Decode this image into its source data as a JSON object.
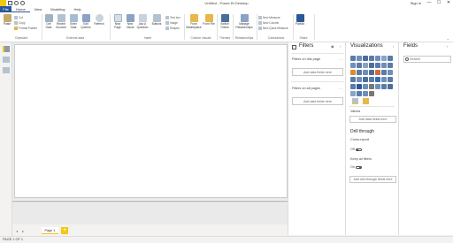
{
  "titlebar": {
    "title": "Untitled - Power BI Desktop",
    "signin": "Sign in",
    "minimize": "—",
    "maximize": "☐",
    "close": "✕"
  },
  "tabs": [
    "File",
    "Home",
    "View",
    "Modeling",
    "Help"
  ],
  "ribbon": {
    "clipboard": {
      "paste": "Paste",
      "cut": "Cut",
      "copy": "Copy",
      "format_painter": "Format Painter",
      "label": "Clipboard"
    },
    "external_data": {
      "get_data": "Get Data",
      "recent_sources": "Recent Sources",
      "enter_data": "Enter Data",
      "edit_queries": "Edit Queries",
      "refresh": "Refresh",
      "label": "External data"
    },
    "insert": {
      "new_page": "New Page",
      "new_visual": "New Visual",
      "ask_a_question": "Ask A Question",
      "buttons": "Buttons",
      "text_box": "Text box",
      "image": "Image",
      "shapes": "Shapes",
      "label": "Insert"
    },
    "custom_visuals": {
      "from_marketplace": "From Marketplace",
      "from_file": "From File",
      "label": "Custom visuals"
    },
    "themes": {
      "switch_theme": "Switch Theme",
      "label": "Themes"
    },
    "relationships": {
      "manage_relationships": "Manage Relationships",
      "label": "Relationships"
    },
    "calculations": {
      "new_measure": "New Measure",
      "new_column": "New Column",
      "new_quick_measure": "New Quick Measure",
      "label": "Calculations"
    },
    "share": {
      "publish": "Publish",
      "label": "Share"
    }
  },
  "canvas": {
    "page_tab": "Page 1",
    "add_page": "+",
    "prev_arrow": "◂",
    "next_arrow": "▸"
  },
  "filters_pane": {
    "title": "Filters",
    "collapse": "›",
    "more": "…",
    "on_this_page": "Filters on this page",
    "on_all_pages": "Filters on all pages",
    "add_fields": "Add data fields here"
  },
  "visualizations_pane": {
    "title": "Visualizations",
    "collapse": "›",
    "values_label": "Values",
    "add_fields": "Add data fields here",
    "drill_through": "Drill through",
    "cross_report": "Cross-report",
    "off": "Off",
    "keep_all_filters": "Keep all filters",
    "on": "On",
    "add_drill": "Add drill-through fields here",
    "visual_colors": [
      "#5b7ba8",
      "#6f8fb8",
      "#4a6e9c",
      "#5b7ba8",
      "#6f8fb8",
      "#8aa3c4",
      "#5b7ba8",
      "#6f8fb8",
      "#5b7ba8",
      "#8aa3c4",
      "#4a6e9c",
      "#5b7ba8",
      "#6f8fb8",
      "#5b7ba8",
      "#e08a2e",
      "#5b7ba8",
      "#6f8fb8",
      "#4a6e9c",
      "#d26a3c",
      "#5b7ba8",
      "#6f8fb8",
      "#5b7ba8",
      "#6f8fb8",
      "#4a6e9c",
      "#5b7ba8",
      "#2f6fb8",
      "#6f8fb8",
      "#5b7ba8",
      "#5b7ba8",
      "#2b579a",
      "#6f8fb8",
      "#777777",
      "#6f8fb8",
      "#5b7ba8",
      "#4a6e9c",
      "#8aa3c4",
      "#5b7ba8",
      "#6f8fb8",
      "#777777"
    ]
  },
  "fields_pane": {
    "title": "Fields",
    "collapse": "›",
    "search_placeholder": "Search"
  },
  "status": {
    "page": "PAGE 1 OF 1"
  },
  "colors": {
    "accent_yellow": "#f2c811",
    "file_blue": "#2b579a"
  }
}
